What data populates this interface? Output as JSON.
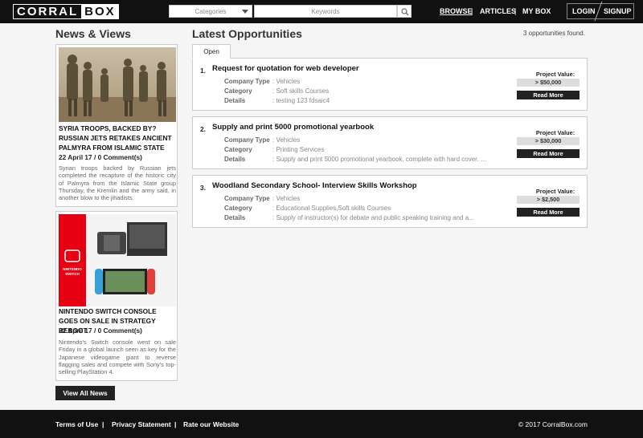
{
  "header": {
    "logo_left": "CORRAL",
    "logo_right": "BOX",
    "categories_label": "Categories",
    "keywords_placeholder": "Keywords",
    "nav": [
      "BROWSE",
      "ARTICLES",
      "MY BOX"
    ],
    "nav_sep": "|",
    "login_label": "LOGIN",
    "signup_label": "SIGNUP"
  },
  "news": {
    "heading": "News & Views",
    "items": [
      {
        "title": "SYRIA TROOPS, BACKED BY? RUSSIAN JETS RETAKES ANCIENT PALMYRA FROM ISLAMIC STATE",
        "meta": "22 April 17 / 0 Comment(s)",
        "body": "Syrian troops backed by Russian jets completed the recapture of the historic city of Palmyra from the Islamic State group Thursday, the Kremlin and the army said, in another blow to the jihadists."
      },
      {
        "title": "NINTENDO SWITCH CONSOLE GOES ON SALE IN STRATEGY REBOOT",
        "meta": "22 April 17 / 0 Comment(s)",
        "body": "Nintendo's Switch console went on sale Friday in a global launch seen as key for the Japanese videogame giant to reverse flagging sales and compete with Sony's top-selling PlayStation 4."
      }
    ],
    "view_all_label": "View All News"
  },
  "opportunities": {
    "heading": "Latest Opportunities",
    "found_text": "3 opportunities found.",
    "tab_label": "Open",
    "field_labels": [
      "Company Type",
      "Category",
      "Details"
    ],
    "project_value_label": "Project Value:",
    "read_more_label": "Read More",
    "items": [
      {
        "num": "1.",
        "title": "Request for quotation for web developer",
        "company_type": ": Vehicles",
        "category": ": Soft skills Courses",
        "details": ": testing 123 fdsaic4",
        "value": "> $50,000"
      },
      {
        "num": "2.",
        "title": "Supply and print 5000 promotional yearbook",
        "company_type": ": Vehicles",
        "category": ": Printing Services",
        "details": ": Supply and print 5000 promotional yearbook, complete with hard cover. ...",
        "value": "> $30,000"
      },
      {
        "num": "3.",
        "title": "Woodland Secondary School- Interview Skills Workshop",
        "company_type": ": Vehicles",
        "category": ": Educational Supplies,Soft skills Courses",
        "details": ": Supply of instructor(s) for debate and public speaking training and a...",
        "value": "> $2,500"
      }
    ]
  },
  "footer": {
    "links": [
      "Terms of Use",
      "Privacy Statement",
      "Rate our Website"
    ],
    "sep": "|",
    "copyright": "© 2017 CorralBox.com"
  },
  "colors": {
    "header_bg": "#111111",
    "accent_dark": "#222222",
    "nintendo_red": "#e60012"
  }
}
